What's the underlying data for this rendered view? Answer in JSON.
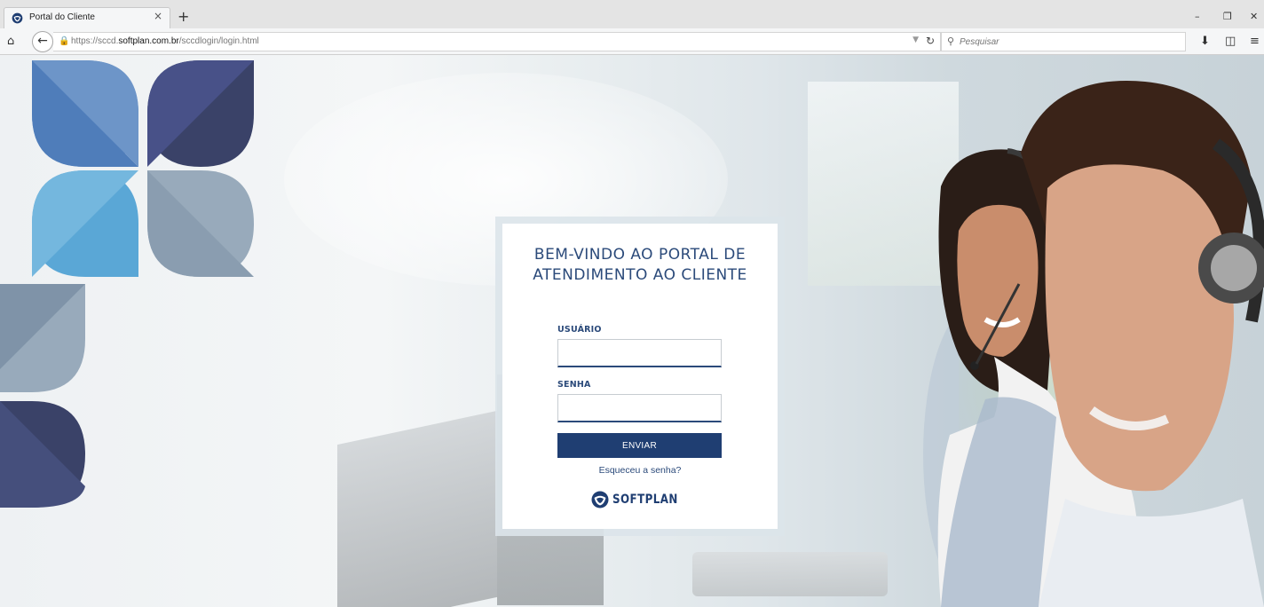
{
  "browser": {
    "tab_title": "Portal do Cliente",
    "tab_close": "×",
    "new_tab": "+",
    "url_prefix": "https://sccd.",
    "url_domain": "softplan.com.br",
    "url_path": "/sccdlogin/login.html",
    "search_placeholder": "Pesquisar",
    "icons": [
      "home-icon",
      "back-arrow-icon",
      "lock-icon",
      "reload-icon",
      "search-icon",
      "download-icon",
      "sidebar-icon",
      "menu-icon",
      "minimize-icon",
      "restore-icon",
      "close-icon"
    ]
  },
  "login": {
    "title_line1": "BEM-VINDO AO PORTAL DE",
    "title_line2": "ATENDIMENTO AO CLIENTE",
    "user_label": "USUÁRIO",
    "user_value": "",
    "password_label": "SENHA",
    "password_value": "",
    "submit_label": "ENVIAR",
    "forgot_label": "Esqueceu a senha?",
    "brand_name": "SOFTPLAN"
  },
  "colors": {
    "brand_navy": "#1f3e72",
    "title_blue": "#2b4a7a",
    "petal_dark": "#3a4268",
    "petal_mid": "#5b86bf",
    "petal_light": "#5aa7d6",
    "petal_grey": "#98aabb"
  }
}
